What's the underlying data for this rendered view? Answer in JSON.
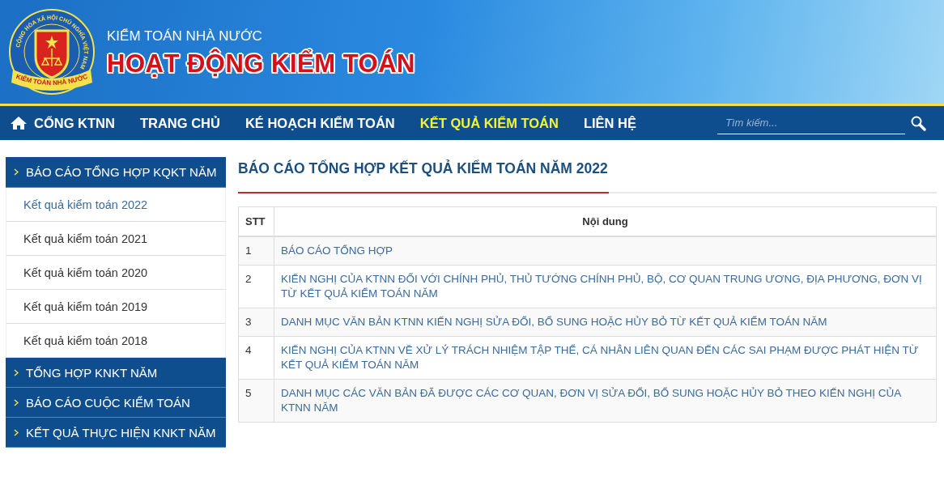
{
  "header": {
    "logo": {
      "ring_text": "CỘNG HÒA XÃ HỘI CHỦ NGHĨA VIỆT NAM",
      "ribbon_text": "KIỂM TOÁN NHÀ NƯỚC"
    },
    "subtitle": "KIỂM TOÁN NHÀ NƯỚC",
    "title": "HOẠT ĐỘNG KIỂM TOÁN"
  },
  "nav": {
    "items": [
      {
        "label": "CỔNG KTNN",
        "kind": "home",
        "selected": false
      },
      {
        "label": "TRANG CHỦ",
        "kind": "link",
        "selected": false
      },
      {
        "label": "KÉ HOẠCH KIỂM TOÁN",
        "kind": "link",
        "selected": false
      },
      {
        "label": "KẾT QUẢ KIỂM TOÁN",
        "kind": "link",
        "selected": true
      },
      {
        "label": "LIÊN HỆ",
        "kind": "link",
        "selected": false
      }
    ],
    "search": {
      "placeholder": "Tìm kiếm..."
    }
  },
  "sidebar": {
    "groups": [
      {
        "label": "BÁO CÁO TỔNG HỢP KQKT NĂM",
        "expanded": true,
        "children": [
          {
            "label": "Kết quả kiểm toán 2022",
            "selected": true
          },
          {
            "label": "Kết quả kiểm toán 2021",
            "selected": false
          },
          {
            "label": "Kết quả kiểm toán 2020",
            "selected": false
          },
          {
            "label": "Kết quả kiểm toán 2019",
            "selected": false
          },
          {
            "label": "Kết quả kiểm toán 2018",
            "selected": false
          }
        ]
      },
      {
        "label": "TỔNG HỢP KNKT NĂM",
        "expanded": false
      },
      {
        "label": "BÁO CÁO CUỘC KIỂM TOÁN",
        "expanded": false
      },
      {
        "label": "KẾT QUẢ THỰC HIỆN KNKT NĂM",
        "expanded": false
      }
    ]
  },
  "main": {
    "heading": "BÁO CÁO TỔNG HỢP KẾT QUẢ KIỂM TOÁN NĂM 2022",
    "table": {
      "columns": [
        "STT",
        "Nội dung"
      ],
      "rows": [
        [
          "1",
          "BÁO CÁO TỔNG HỢP"
        ],
        [
          "2",
          "KIẾN NGHỊ CỦA KTNN ĐỐI VỚI CHÍNH PHỦ, THỦ TƯỚNG CHÍNH PHỦ, BỘ, CƠ QUAN TRUNG ƯƠNG, ĐỊA PHƯƠNG, ĐƠN VỊ TỪ KẾT QUẢ KIỂM TOÁN NĂM"
        ],
        [
          "3",
          "DANH MỤC VĂN BẢN KTNN KIẾN NGHỊ SỬA ĐỔI, BỔ SUNG HOẶC HỦY BỎ TỪ KẾT QUẢ KIỂM TOÁN NĂM"
        ],
        [
          "4",
          "KIẾN NGHỊ CỦA KTNN VỀ XỬ LÝ TRÁCH NHIỆM TẬP THỂ, CÁ NHÂN LIÊN QUAN ĐẾN CÁC SAI PHẠM ĐƯỢC PHÁT HIỆN TỪ KẾT QUẢ KIỂM TOÁN NĂM"
        ],
        [
          "5",
          "DANH MỤC CÁC VĂN BẢN ĐÃ ĐƯỢC CÁC CƠ QUAN, ĐƠN VỊ SỬA ĐỔI, BỔ SUNG HOẶC HỦY BỎ THEO KIẾN NGHỊ CỦA KTNN NĂM"
        ]
      ]
    }
  }
}
